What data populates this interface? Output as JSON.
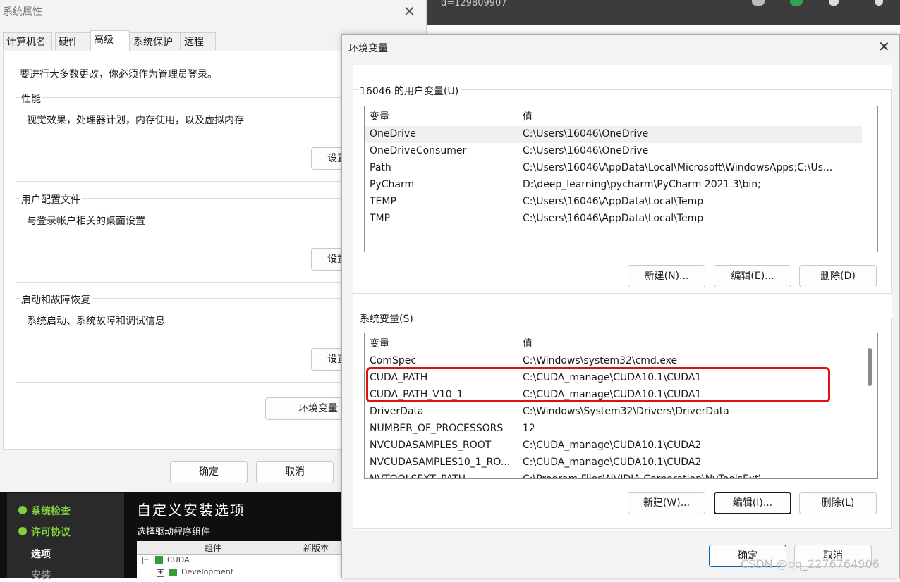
{
  "browser": {
    "url_fragment": "d=129809907",
    "page_text": "· · ·"
  },
  "sysprop": {
    "title": "系统属性",
    "close": "✕",
    "tabs": [
      "计算机名",
      "硬件",
      "高级",
      "系统保护",
      "远程"
    ],
    "admin_note": "要进行大多数更改，你必须作为管理员登录。",
    "groups": [
      {
        "title": "性能",
        "desc": "视觉效果，处理器计划，内存使用，以及虚拟内存",
        "button": "设置"
      },
      {
        "title": "用户配置文件",
        "desc": "与登录帐户相关的桌面设置",
        "button": "设置"
      },
      {
        "title": "启动和故障恢复",
        "desc": "系统启动、系统故障和调试信息",
        "button": "设置"
      }
    ],
    "env_button": "环境变量",
    "ok": "确定",
    "cancel": "取消"
  },
  "installer": {
    "steps": [
      "系统检查",
      "许可协议",
      "选项",
      "安装"
    ],
    "title": "自定义安装选项",
    "subtitle": "选择驱动程序组件",
    "col_component": "组件",
    "col_new_version": "新版本",
    "items": [
      "CUDA",
      "Development"
    ]
  },
  "envdlg": {
    "title": "环境变量",
    "close": "✕",
    "user_section": "16046 的用户变量(U)",
    "col_var": "变量",
    "col_val": "值",
    "user_vars": [
      {
        "name": "OneDrive",
        "value": "C:\\Users\\16046\\OneDrive"
      },
      {
        "name": "OneDriveConsumer",
        "value": "C:\\Users\\16046\\OneDrive"
      },
      {
        "name": "Path",
        "value": "C:\\Users\\16046\\AppData\\Local\\Microsoft\\WindowsApps;C:\\Us..."
      },
      {
        "name": "PyCharm",
        "value": "D:\\deep_learning\\pycharm\\PyCharm 2021.3\\bin;"
      },
      {
        "name": "TEMP",
        "value": "C:\\Users\\16046\\AppData\\Local\\Temp"
      },
      {
        "name": "TMP",
        "value": "C:\\Users\\16046\\AppData\\Local\\Temp"
      }
    ],
    "user_buttons": {
      "new": "新建(N)...",
      "edit": "编辑(E)...",
      "delete": "删除(D)"
    },
    "system_section": "系统变量(S)",
    "system_vars": [
      {
        "name": "ComSpec",
        "value": "C:\\Windows\\system32\\cmd.exe"
      },
      {
        "name": "CUDA_PATH",
        "value": "C:\\CUDA_manage\\CUDA10.1\\CUDA1"
      },
      {
        "name": "CUDA_PATH_V10_1",
        "value": "C:\\CUDA_manage\\CUDA10.1\\CUDA1"
      },
      {
        "name": "DriverData",
        "value": "C:\\Windows\\System32\\Drivers\\DriverData"
      },
      {
        "name": "NUMBER_OF_PROCESSORS",
        "value": "12"
      },
      {
        "name": "NVCUDASAMPLES_ROOT",
        "value": "C:\\CUDA_manage\\CUDA10.1\\CUDA2"
      },
      {
        "name": "NVCUDASAMPLES10_1_RO...",
        "value": "C:\\CUDA_manage\\CUDA10.1\\CUDA2"
      },
      {
        "name": "NVTOOLSEXT_PATH",
        "value": "C:\\Program Files\\NVIDIA Corporation\\NvToolsExt\\"
      }
    ],
    "system_buttons": {
      "new": "新建(W)...",
      "edit": "编辑(I)...",
      "delete": "删除(L)"
    },
    "ok": "确定",
    "cancel": "取消",
    "highlight_color": "#e01010"
  },
  "watermark": "CSDN @qq_2276764906"
}
